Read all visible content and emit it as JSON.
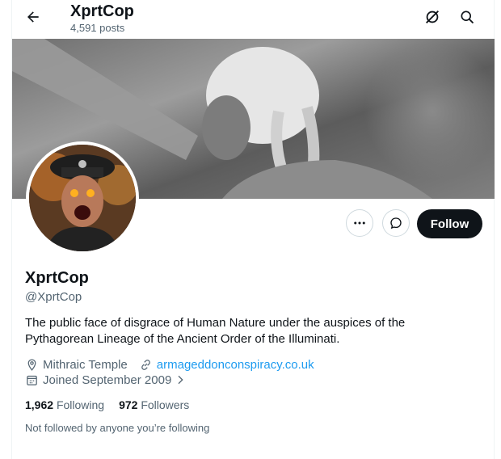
{
  "header": {
    "title": "XprtCop",
    "post_count": "4,591 posts"
  },
  "profile": {
    "name": "XprtCop",
    "handle": "@XprtCop",
    "bio": "The public face of disgrace of Human Nature under the auspices of the Pythagorean Lineage of the Ancient Order of the Illuminati.",
    "location": "Mithraic Temple",
    "website": "armageddonconspiracy.co.uk",
    "joined": "Joined September 2009"
  },
  "actions": {
    "follow_label": "Follow"
  },
  "stats": {
    "following_count": "1,962",
    "following_label": "Following",
    "followers_count": "972",
    "followers_label": "Followers"
  },
  "not_followed_text": "Not followed by anyone you’re following",
  "icons": {
    "back": "arrow-left-icon",
    "grok": "grok-icon",
    "search": "search-icon",
    "more": "more-icon",
    "message": "message-icon",
    "location": "location-pin-icon",
    "link": "link-icon",
    "calendar": "calendar-icon",
    "chevron": "chevron-right-icon"
  },
  "colors": {
    "follow_bg": "#0f1419",
    "link": "#1d9bf0",
    "secondary_text": "#536471"
  }
}
